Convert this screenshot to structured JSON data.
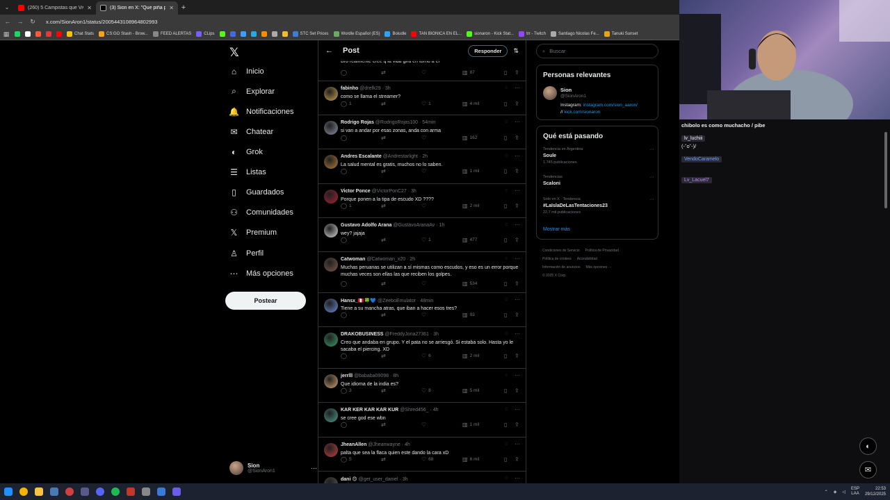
{
  "browser": {
    "tabs": [
      {
        "title": "(260) 5 Campistas que Vivieron...",
        "fav": "#ff0000",
        "active": false
      },
      {
        "title": "(3) Sion en X: \"Que piña pe chi...",
        "fav": "#ffffff",
        "active": true
      }
    ],
    "url": "x.com/SionAron1/status/2005443108964802993",
    "bookmarks": [
      {
        "label": "",
        "color": "#1ed760"
      },
      {
        "label": "",
        "color": "#ffffff"
      },
      {
        "label": "",
        "color": "#ff5a36"
      },
      {
        "label": "",
        "color": "#e03a3a"
      },
      {
        "label": "",
        "color": "#ff0000"
      },
      {
        "label": "Chat Stats",
        "color": "#f4c20d"
      },
      {
        "label": "CS:GO Stash - Brow...",
        "color": "#f4a020"
      },
      {
        "label": "FEED ALERTAS",
        "color": "#888888"
      },
      {
        "label": "CLips",
        "color": "#7b5cff"
      },
      {
        "label": "",
        "color": "#53fc18"
      },
      {
        "label": "",
        "color": "#4169e1"
      },
      {
        "label": "",
        "color": "#3aa0ff"
      },
      {
        "label": "",
        "color": "#2aa8e0"
      },
      {
        "label": "",
        "color": "#ff8c00"
      },
      {
        "label": "",
        "color": "#aaaaaa"
      },
      {
        "label": "",
        "color": "#f3ba2f"
      },
      {
        "label": "STC Set Prices",
        "color": "#3c7dd9"
      },
      {
        "label": "Wordle Español (ES)",
        "color": "#6aaa64"
      },
      {
        "label": "Boiudle",
        "color": "#2fa2ff"
      },
      {
        "label": "TAN BIONICA EN EL...",
        "color": "#ff0000"
      },
      {
        "label": "sionaron - Kick Stat...",
        "color": "#53fc18"
      },
      {
        "label": "trr - Twitch",
        "color": "#9146ff"
      },
      {
        "label": "Santiago Nicolas Fe...",
        "color": "#aaaaaa"
      },
      {
        "label": "Tanuki Sunset",
        "color": "#e8a317"
      }
    ]
  },
  "nav": {
    "items": [
      {
        "label": "Inicio",
        "icon": "home-icon",
        "glyph": "⌂"
      },
      {
        "label": "Explorar",
        "icon": "search-icon",
        "glyph": "⌕"
      },
      {
        "label": "Notificaciones",
        "icon": "bell-icon",
        "glyph": "🔔"
      },
      {
        "label": "Chatear",
        "icon": "mail-icon",
        "glyph": "✉"
      },
      {
        "label": "Grok",
        "icon": "grok-icon",
        "glyph": "◐"
      },
      {
        "label": "Listas",
        "icon": "list-icon",
        "glyph": "☰"
      },
      {
        "label": "Guardados",
        "icon": "bookmark-icon",
        "glyph": "▯"
      },
      {
        "label": "Comunidades",
        "icon": "communities-icon",
        "glyph": "⚇"
      },
      {
        "label": "Premium",
        "icon": "x-premium-icon",
        "glyph": "𝕏"
      },
      {
        "label": "Perfil",
        "icon": "profile-icon",
        "glyph": "♙"
      },
      {
        "label": "Más opciones",
        "icon": "more-options-icon",
        "glyph": "⋯"
      }
    ],
    "post_label": "Postear",
    "account": {
      "name": "Sion",
      "handle": "@SionAron1"
    }
  },
  "center": {
    "title": "Post",
    "reply_button": "Responder",
    "first_line": "Bro realmente cree q la vida gira en torno a el",
    "first_views": "87",
    "tweets": [
      {
        "name": "fabinho",
        "handle": "@drefk29 · 3h",
        "text": "como se llama el streamer?",
        "replies": "1",
        "likes": "1",
        "views": "4 mil",
        "color": "#c9a24b"
      },
      {
        "name": "Rodrigo Rojas",
        "handle": "@RodrigoRojas100 · 54min",
        "text": "si van a andar por esas zonas, anda con arma",
        "replies": "",
        "likes": "",
        "views": "162",
        "color": "#8b8fa0"
      },
      {
        "name": "Andres Escalante",
        "handle": "@Andrestarlight · 2h",
        "text": "La salud mental es gratis, muchos no lo saben.",
        "replies": "",
        "likes": "",
        "views": "1 mil",
        "color": "#b07a3a"
      },
      {
        "name": "Victor Ponce",
        "handle": "@VictorPonC27 · 3h",
        "text": "Porque ponen a la tipa de escudo XD ????",
        "replies": "1",
        "likes": "",
        "views": "2 mil",
        "color": "#a8203a"
      },
      {
        "name": "Gustavo Adolfo Arana",
        "handle": "@GustavoAranaAv · 1h",
        "text": "wey? jajaja",
        "replies": "",
        "likes": "1",
        "views": "477",
        "color": "#d8d8d8"
      },
      {
        "name": "Catwoman",
        "handle": "@Catwoman_x20 · 2h",
        "text": "Muchas peruanas se utilizan a sí mismas como escudos, y eso es un error porque muchas veces son ellas las que reciben los golpes.",
        "replies": "",
        "likes": "",
        "views": "534",
        "color": "#7a5a4a"
      },
      {
        "name": "Hansx_🇵🇪🍀💙",
        "handle": "@ZeeboEmulator · 48min",
        "text": "Tiene a su mancha atras, que iban a hacer esos tres?",
        "replies": "",
        "likes": "",
        "views": "93",
        "color": "#6a8ad0"
      },
      {
        "name": "DRAKOBUSINESS",
        "handle": "@FreddyJona27361 · 3h",
        "text": "Creo que andaba en grupo. Y el pata no se arriesgó. Si estaba solo. Hasta yo le sacaba el piercing. XD",
        "replies": "",
        "likes": "6",
        "views": "2 mil",
        "color": "#3a9a6a"
      },
      {
        "name": "jerrlll",
        "handle": "@bababa09098 · 8h",
        "text": "Que idioma de la india es?",
        "replies": "3",
        "likes": "8",
        "views": "5 mil",
        "color": "#d0a070"
      },
      {
        "name": "KAR KER KAR KAR KUR",
        "handle": "@Shred456_ · 4h",
        "text": "se cree god ese wbn",
        "replies": "",
        "likes": "",
        "views": "1 mil",
        "color": "#4a9a8a"
      },
      {
        "name": "JheanAllen",
        "handle": "@Jheanwayne · 4h",
        "text": "palta que sea la flaca quien este dando la cara  xD",
        "replies": "5",
        "likes": "68",
        "views": "6 mil",
        "color": "#c04040"
      },
      {
        "name": "dani 😊",
        "handle": "@get_user_daniel · 3h",
        "text": "",
        "replies": "",
        "likes": "",
        "views": "",
        "color": "#555555"
      }
    ]
  },
  "right": {
    "search_placeholder": "Buscar",
    "relevant_title": "Personas relevantes",
    "relevant": {
      "name": "Sion",
      "handle": "@SionAron1",
      "bio_prefix": "Instagram: ",
      "bio_link1": "instagram.com/sion_aaron/",
      "bio_mid": "// ",
      "bio_link2": "kick.com/sionaron"
    },
    "trends_title": "Qué está pasando",
    "trends": [
      {
        "context": "Tendencia en Argentina",
        "title": "Soule",
        "count": "1.745 publicaciones"
      },
      {
        "context": "Tendencias",
        "title": "Scaloni",
        "count": ""
      },
      {
        "context": "Solo en X · Tendencia",
        "title": "#LaIslaDeLasTentaciones23",
        "count": "22,7 mil publicaciones"
      }
    ],
    "show_more": "Mostrar más",
    "footer": [
      "Condiciones de Servicio",
      "Política de Privacidad",
      "Política de cookies",
      "Accesibilidad",
      "Información de anuncios",
      "Más opciones ···",
      "© 2025 X Corp."
    ]
  },
  "stream": {
    "chat": [
      {
        "user": "",
        "text": "chibolo es como muchacho / pibe",
        "color": "#efeff1"
      },
      {
        "user": "lv_luchiii",
        "text": "(-˘o˘-)/",
        "color": "#efeff1"
      },
      {
        "user": "VendoCaramelo",
        "text": "",
        "color": "#6fa0ff"
      },
      {
        "user": "Lv_Lacuel7",
        "text": "",
        "color": "#c58bff"
      }
    ]
  },
  "taskbar": {
    "lang": "ESP",
    "region": "LAA",
    "time": "22:53",
    "date": "29/12/2025"
  }
}
